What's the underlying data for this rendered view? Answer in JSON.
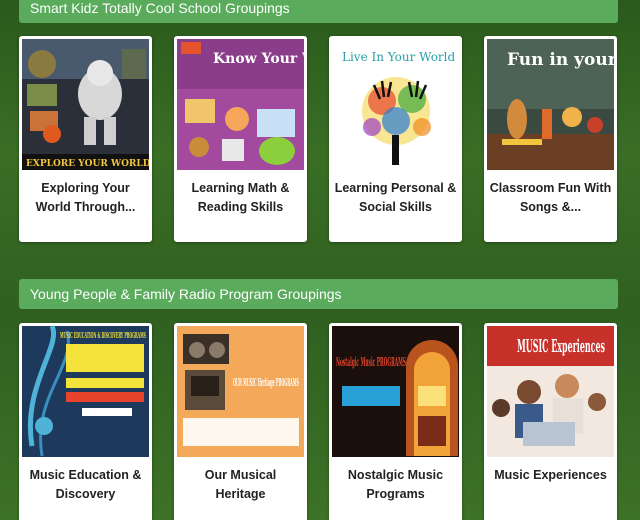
{
  "sections": [
    {
      "title": "Smart Kidz Totally Cool School Groupings",
      "cards": [
        {
          "title": "Exploring Your World Through...",
          "image_text": "EXPLORE YOUR WORLD"
        },
        {
          "title": "Learning Math & Reading Skills",
          "image_text": "Know Your World"
        },
        {
          "title": "Learning Personal & Social Skills",
          "image_text": "Live In Your World"
        },
        {
          "title": "Classroom Fun With Songs &...",
          "image_text": "Fun in your World"
        }
      ]
    },
    {
      "title": "Young People & Family Radio Program Groupings",
      "cards": [
        {
          "title": "Music Education & Discovery",
          "image_text": "MUSIC EDUCATION & DISCOVERY PROGRAMS"
        },
        {
          "title": "Our Musical Heritage",
          "image_text": "OUR MUSIC Heritage PROGRAMS"
        },
        {
          "title": "Nostalgic Music Programs",
          "image_text": "Nostalgic Music PROGRAMS"
        },
        {
          "title": "Music Experiences",
          "image_text": "MUSIC Experiences"
        }
      ]
    }
  ],
  "colors": {
    "header_bg": "#5aab5c",
    "page_bg": "#2f6020",
    "card_bg": "#ffffff"
  }
}
